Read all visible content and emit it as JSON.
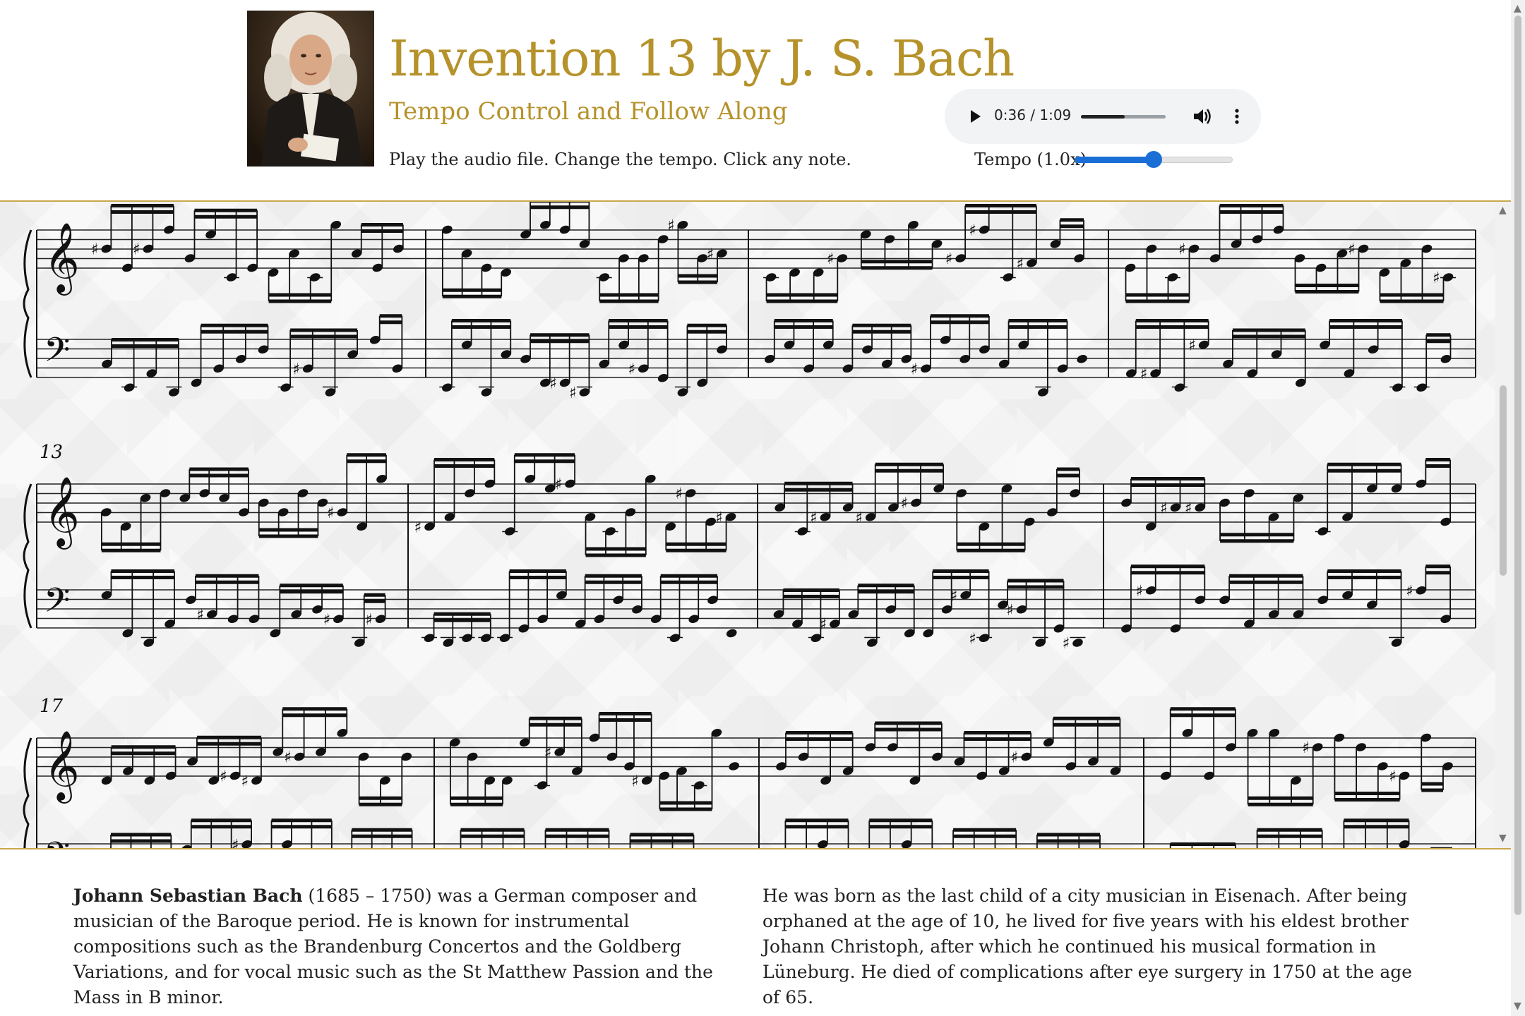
{
  "header": {
    "portrait_alt": "Portrait of J. S. Bach",
    "title": "Invention 13 by J. S. Bach",
    "subtitle": "Tempo Control and Follow Along",
    "instructions": "Play the audio file. Change the tempo. Click any note."
  },
  "player": {
    "time": "0:36 / 1:09",
    "progress": 0.52,
    "play_icon": "play-icon",
    "volume_icon": "volume-icon",
    "more_icon": "more-vertical-icon"
  },
  "tempo": {
    "label": "Tempo (1.0x)",
    "value": 0.5
  },
  "score": {
    "systems": [
      {
        "measure_number": ""
      },
      {
        "measure_number": "13"
      },
      {
        "measure_number": "17"
      }
    ]
  },
  "bio": {
    "left_name": "Johann Sebastian Bach",
    "left_text": " (1685 – 1750) was a German composer and musician of the Baroque period. He is known for instrumental compositions such as the Brandenburg Concertos and the Goldberg Variations, and for vocal music such as the St Matthew Passion and the Mass in B minor.",
    "right_text": "He was born as the last child of a city musician in Eisenach. After being orphaned at the age of 10, he lived for five years with his eldest brother Johann Christoph, after which he continued his musical formation in Lüneburg. He died of complications after eye surgery in 1750 at the age of 65."
  },
  "colors": {
    "gold": "#b5922a",
    "accent_blue": "#1a6fd6"
  }
}
